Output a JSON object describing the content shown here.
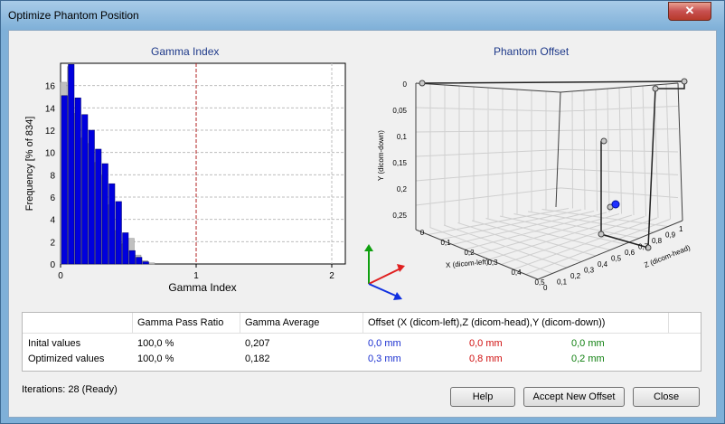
{
  "window": {
    "title": "Optimize Phantom Position",
    "close_glyph": "✕"
  },
  "histogram": {
    "title": "Gamma Index",
    "xlabel": "Gamma Index",
    "ylabel": "Frequency [% of 834]",
    "x_ticks": [
      "0",
      "1",
      "2"
    ],
    "y_ticks": [
      "0",
      "2",
      "4",
      "6",
      "8",
      "10",
      "12",
      "14",
      "16"
    ]
  },
  "offset3d": {
    "title": "Phantom Offset",
    "y_axis_label": "Y (dicom-down)",
    "x_axis_label": "X (dicom-left)",
    "z_axis_label": "Z (dicom-head)",
    "y_ticks": [
      "0",
      "0,05",
      "0,1",
      "0,15",
      "0,2",
      "0,25"
    ],
    "x_ticks": [
      "0",
      "0,1",
      "0,2",
      "0,3",
      "0,4",
      "0,5"
    ],
    "z_ticks": [
      "0",
      "0,1",
      "0,2",
      "0,3",
      "0,4",
      "0,5",
      "0,6",
      "0,7",
      "0,8",
      "0,9",
      "1"
    ]
  },
  "chart_data": [
    {
      "type": "bar",
      "title": "Gamma Index",
      "xlabel": "Gamma Index",
      "ylabel": "Frequency [% of 834]",
      "xlim": [
        0,
        2.1
      ],
      "ylim": [
        0,
        18
      ],
      "bin_width": 0.05,
      "bin_starts": [
        0,
        0.05,
        0.1,
        0.15,
        0.2,
        0.25,
        0.3,
        0.35,
        0.4,
        0.45,
        0.5,
        0.55,
        0.6,
        0.65
      ],
      "series": [
        {
          "name": "Initial",
          "color": "#c0c0c0",
          "values": [
            16.3,
            17.7,
            13.5,
            11.3,
            10.8,
            9.1,
            7.9,
            5.3,
            3.0,
            1.8,
            2.3,
            0.8,
            0.3,
            0.1
          ]
        },
        {
          "name": "Optimized",
          "color": "#0000dd",
          "values": [
            15.1,
            17.9,
            14.9,
            13.4,
            12.0,
            10.3,
            9.0,
            7.2,
            5.6,
            2.8,
            1.2,
            0.6,
            0.2,
            0
          ]
        }
      ],
      "threshold": 1,
      "grid": true
    },
    {
      "type": "scatter",
      "title": "Phantom Offset",
      "series": [
        {
          "name": "Initial",
          "color": "#0000ff",
          "x": [
            0.0
          ],
          "z": [
            0.8
          ],
          "y": [
            0.2
          ]
        },
        {
          "name": "Optimized",
          "color": "#888888",
          "x": [
            0.3
          ],
          "z": [
            0.8
          ],
          "y": [
            0.2
          ]
        }
      ]
    }
  ],
  "table": {
    "headers": [
      "Gamma Pass Ratio",
      "Gamma Average",
      "Offset (X (dicom-left),Z (dicom-head),Y (dicom-down))"
    ],
    "rows": [
      {
        "label": "Inital values",
        "pass": "100,0 %",
        "avg": "0,207",
        "x": "0,0 mm",
        "z": "0,0 mm",
        "y": "0,0 mm"
      },
      {
        "label": "Optimized values",
        "pass": "100,0 %",
        "avg": "0,182",
        "x": "0,3 mm",
        "z": "0,8 mm",
        "y": "0,2 mm"
      }
    ],
    "colors": {
      "x": "#1a2fd0",
      "z": "#d01010",
      "y": "#108010"
    }
  },
  "status": "Iterations: 28  (Ready)",
  "buttons": {
    "help": "Help",
    "accept": "Accept New Offset",
    "close": "Close"
  }
}
